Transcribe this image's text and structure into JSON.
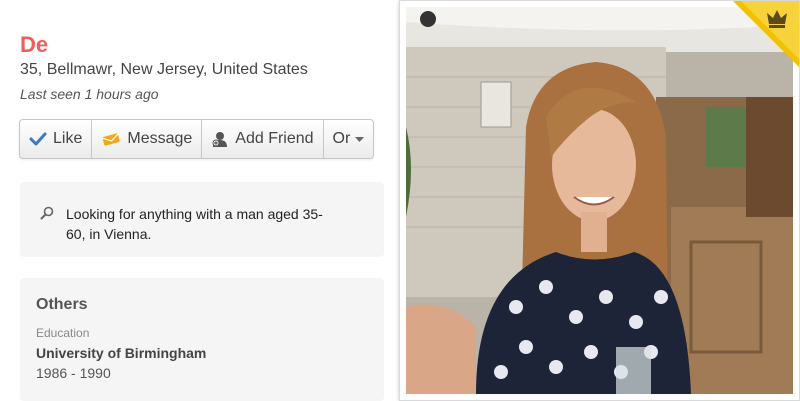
{
  "profile": {
    "name": "De",
    "location": "35, Bellmawr, New Jersey, United States",
    "last_seen": "Last seen 1 hours ago"
  },
  "actions": {
    "like_label": "Like",
    "message_label": "Message",
    "add_friend_label": "Add Friend",
    "or_label": "Or"
  },
  "looking_for": {
    "text": "Looking for anything with a man aged 35-60, in Vienna."
  },
  "others": {
    "title": "Others",
    "education_label": "Education",
    "school": "University of Birmingham",
    "years": "1986 - 1990"
  },
  "badge": {
    "icon": "crown-icon",
    "color": "#f2c200"
  },
  "colors": {
    "name": "#ee5f5b",
    "like_check": "#3a79c4",
    "message_icon": "#f0a818"
  }
}
